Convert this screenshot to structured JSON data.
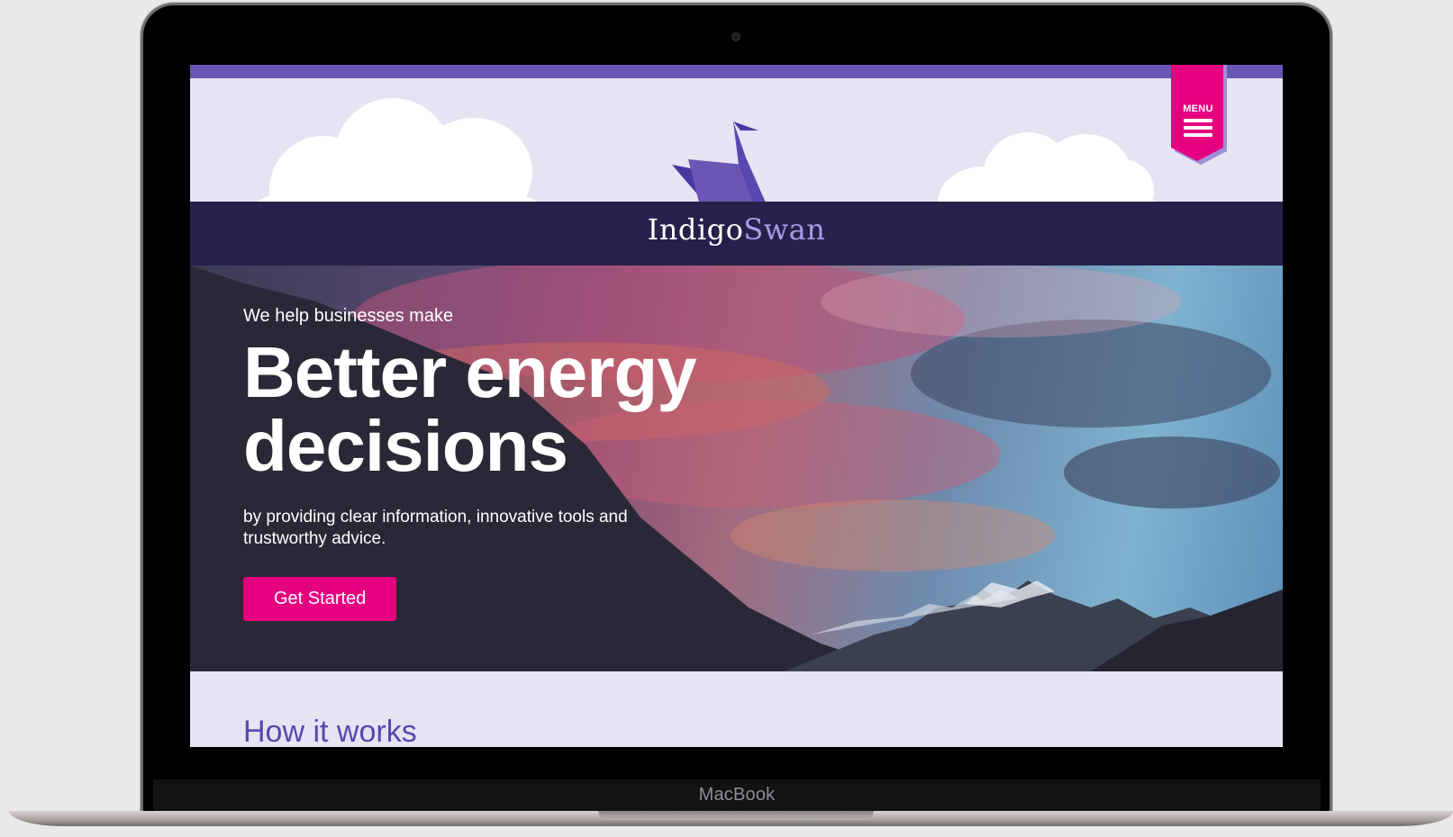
{
  "device": {
    "brand_label": "MacBook"
  },
  "site": {
    "logo": {
      "part1": "Indigo",
      "part2": "Swan"
    },
    "menu": {
      "label": "MENU"
    },
    "colors": {
      "accent": "#e5007f",
      "brand_purple": "#6a56b5",
      "navy": "#26214a",
      "light_lavender": "#e6e3f3"
    }
  },
  "hero": {
    "kicker": "We help businesses make",
    "title_line1": "Better energy",
    "title_line2": "decisions",
    "subtitle": "by providing clear information, innovative tools and trustworthy advice.",
    "cta_label": "Get Started"
  },
  "section": {
    "title": "How it works"
  }
}
